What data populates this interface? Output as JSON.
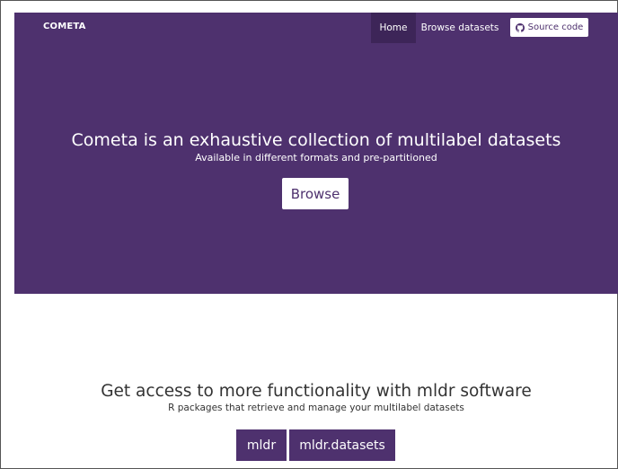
{
  "colors": {
    "brand_purple": "#4e316e",
    "nav_active": "#3d2558",
    "text_dark": "#333333",
    "white": "#ffffff"
  },
  "navbar": {
    "brand": "COMETA",
    "items": [
      {
        "label": "Home",
        "active": true
      },
      {
        "label": "Browse datasets",
        "active": false
      }
    ],
    "source_button": {
      "label": "Source code",
      "icon": "github-icon"
    }
  },
  "hero": {
    "title": "Cometa is an exhaustive collection of multilabel datasets",
    "subtitle": "Available in different formats and pre-partitioned",
    "button_label": "Browse"
  },
  "software": {
    "title": "Get access to more functionality with mldr software",
    "subtitle": "R packages that retrieve and manage your multilabel datasets",
    "packages": [
      "mldr",
      "mldr.datasets"
    ]
  }
}
